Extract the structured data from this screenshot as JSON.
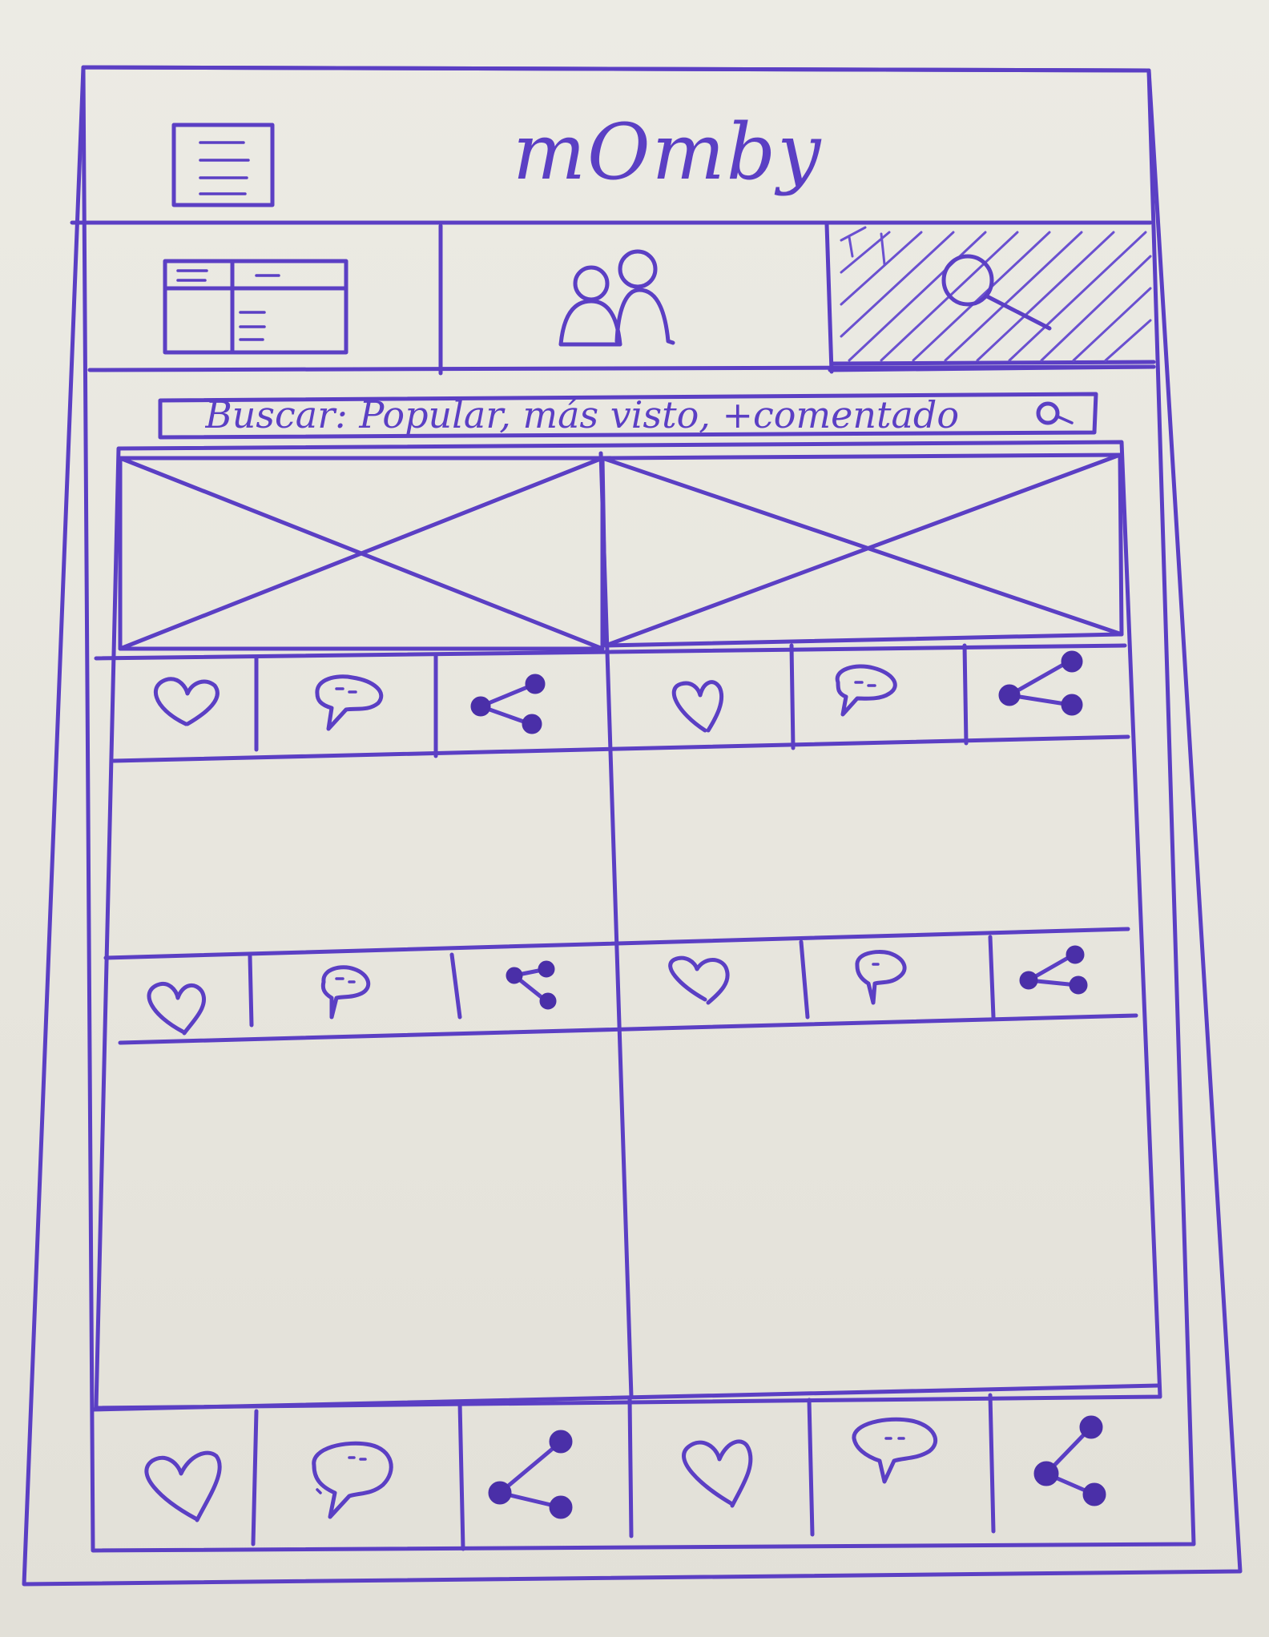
{
  "app": {
    "logo_text": "mOmby"
  },
  "header": {
    "menu_icon": "hamburger-menu-icon"
  },
  "tabs": [
    {
      "icon": "grid-layout-icon",
      "selected": false
    },
    {
      "icon": "people-icon",
      "selected": false
    },
    {
      "icon": "search-icon",
      "selected": true
    }
  ],
  "search": {
    "text": "Buscar: Popular, más visto, +comentado"
  },
  "feed": {
    "cards": [
      {
        "has_image": true,
        "actions": [
          "heart-icon",
          "comment-icon",
          "share-icon"
        ]
      },
      {
        "has_image": true,
        "actions": [
          "heart-icon",
          "comment-icon",
          "share-icon"
        ]
      },
      {
        "has_image": false,
        "actions": [
          "heart-icon",
          "comment-icon",
          "share-icon"
        ]
      },
      {
        "has_image": false,
        "actions": [
          "heart-icon",
          "comment-icon",
          "share-icon"
        ]
      },
      {
        "has_image": false,
        "actions": [
          "heart-icon",
          "comment-icon",
          "share-icon"
        ]
      },
      {
        "has_image": false,
        "actions": [
          "heart-icon",
          "comment-icon",
          "share-icon"
        ]
      }
    ]
  },
  "colors": {
    "ink": "#5b3fc4",
    "paper": "#ecebe4"
  }
}
